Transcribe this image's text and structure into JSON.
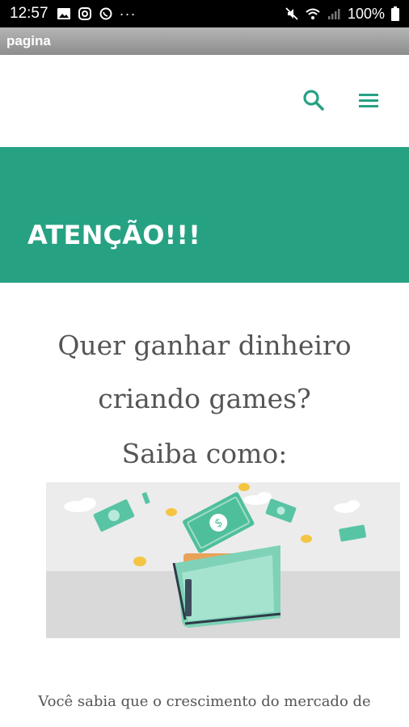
{
  "status_bar": {
    "time": "12:57",
    "battery": "100%",
    "icons": [
      "image-icon",
      "instagram-icon",
      "whatsapp-icon",
      "more-icon",
      "mute-icon",
      "wifi-icon",
      "signal-icon",
      "battery-icon"
    ]
  },
  "app_bar": {
    "title": "pagina"
  },
  "header": {
    "icons": [
      "search-icon",
      "menu-icon"
    ],
    "accent_color": "#26a283"
  },
  "banner": {
    "title": "ATENÇÃO!!!",
    "background": "#26a283"
  },
  "headline": {
    "lines": [
      "Quer ganhar dinheiro",
      "criando games?",
      "Saiba como:"
    ]
  },
  "hero": {
    "icon": "wallet-money-illustration"
  },
  "body": {
    "text": "Você sabia que o crescimento do mercado de"
  }
}
